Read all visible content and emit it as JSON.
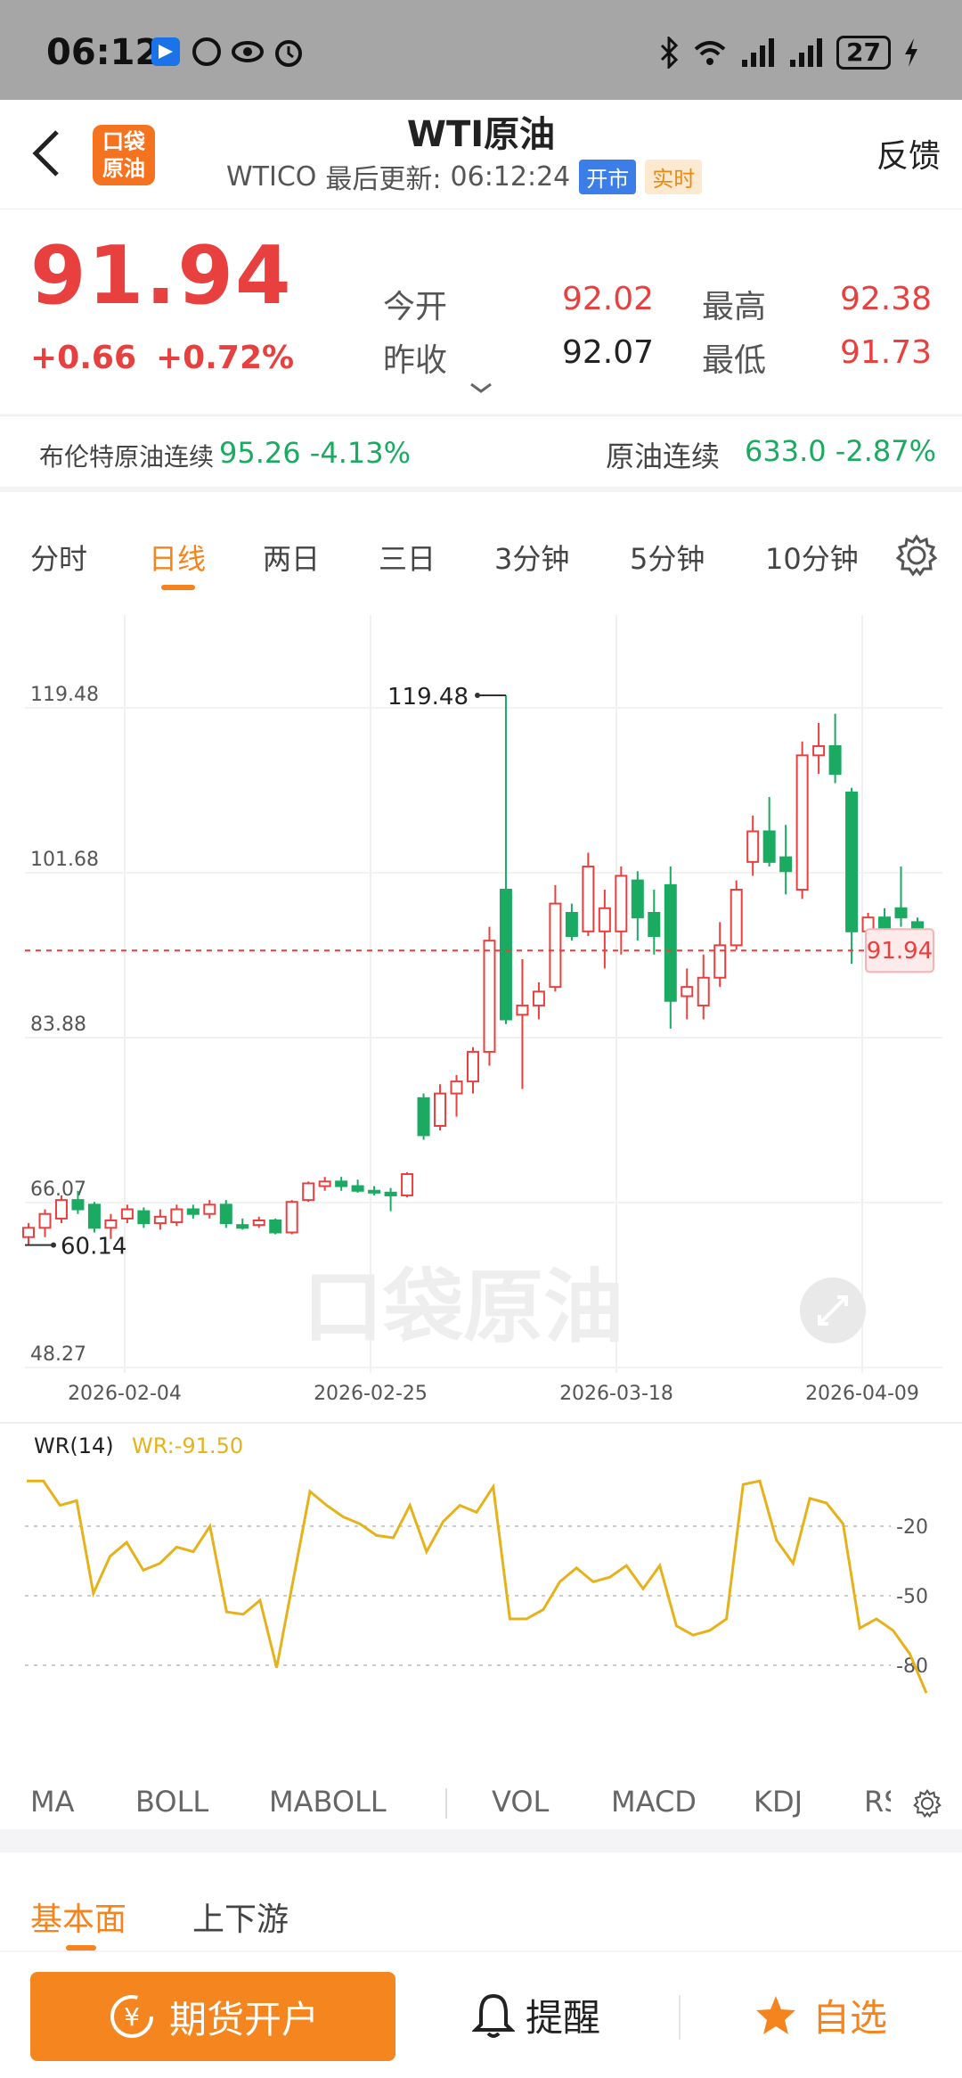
{
  "status_bar": {
    "time": "06:12",
    "battery": "27"
  },
  "header": {
    "logo_text_top": "口袋",
    "logo_text_bottom": "原油",
    "title": "WTI原油",
    "code": "WTICO",
    "update_label": "最后更新:",
    "update_time": "06:12:24",
    "tag_open": "开市",
    "tag_live": "实时",
    "feedback": "反馈"
  },
  "quote": {
    "price": "91.94",
    "change": "+0.66",
    "change_pct": "+0.72%",
    "open_label": "今开",
    "open_value": "92.02",
    "high_label": "最高",
    "high_value": "92.38",
    "prev_close_label": "昨收",
    "prev_close_value": "92.07",
    "low_label": "最低",
    "low_value": "91.73",
    "colors": {
      "up": "#e8403f",
      "down": "#1aaa62"
    }
  },
  "related": {
    "brent_label": "布伦特原油连续",
    "brent_value": "95.26 -4.13%",
    "crude_label": "原油连续",
    "crude_value": "633.0 -2.87%"
  },
  "tabs": [
    {
      "label": "分时",
      "active": false
    },
    {
      "label": "日线",
      "active": true
    },
    {
      "label": "两日",
      "active": false
    },
    {
      "label": "三日",
      "active": false
    },
    {
      "label": "3分钟",
      "active": false
    },
    {
      "label": "5分钟",
      "active": false
    },
    {
      "label": "10分钟",
      "active": false
    }
  ],
  "chart_data": {
    "type": "candlestick",
    "title": "",
    "y_ticks": [
      "119.48",
      "101.68",
      "83.88",
      "66.07",
      "48.27"
    ],
    "ylim": [
      48.27,
      119.48
    ],
    "x_ticks": [
      "2026-02-04",
      "2026-02-25",
      "2026-03-18",
      "2026-04-09"
    ],
    "max_label": "119.48",
    "min_label": "60.14",
    "last_price_label": "91.94",
    "last_price": 91.94,
    "watermark": "口袋原油",
    "candles": [
      {
        "o": 61.0,
        "h": 62.5,
        "l": 60.14,
        "c": 62.0
      },
      {
        "o": 62.0,
        "h": 64.0,
        "l": 61.0,
        "c": 63.5
      },
      {
        "o": 63.0,
        "h": 65.5,
        "l": 62.5,
        "c": 65.0
      },
      {
        "o": 65.0,
        "h": 66.0,
        "l": 63.5,
        "c": 64.0
      },
      {
        "o": 64.5,
        "h": 64.8,
        "l": 61.5,
        "c": 62.0
      },
      {
        "o": 62.0,
        "h": 63.5,
        "l": 60.8,
        "c": 62.8
      },
      {
        "o": 63.0,
        "h": 64.5,
        "l": 62.5,
        "c": 64.0
      },
      {
        "o": 63.8,
        "h": 64.2,
        "l": 62.0,
        "c": 62.5
      },
      {
        "o": 62.5,
        "h": 64.0,
        "l": 61.8,
        "c": 63.2
      },
      {
        "o": 62.6,
        "h": 64.5,
        "l": 62.2,
        "c": 64.0
      },
      {
        "o": 64.0,
        "h": 64.5,
        "l": 63.0,
        "c": 63.5
      },
      {
        "o": 63.5,
        "h": 65.0,
        "l": 63.0,
        "c": 64.5
      },
      {
        "o": 64.5,
        "h": 65.0,
        "l": 62.0,
        "c": 62.5
      },
      {
        "o": 62.3,
        "h": 63.0,
        "l": 61.8,
        "c": 62.0
      },
      {
        "o": 62.3,
        "h": 63.2,
        "l": 62.0,
        "c": 62.8
      },
      {
        "o": 62.8,
        "h": 63.0,
        "l": 61.3,
        "c": 61.5
      },
      {
        "o": 61.5,
        "h": 65.0,
        "l": 61.3,
        "c": 64.8
      },
      {
        "o": 65.0,
        "h": 67.0,
        "l": 64.8,
        "c": 66.8
      },
      {
        "o": 66.5,
        "h": 67.5,
        "l": 66.0,
        "c": 67.0
      },
      {
        "o": 67.0,
        "h": 67.5,
        "l": 66.0,
        "c": 66.5
      },
      {
        "o": 66.5,
        "h": 67.2,
        "l": 65.8,
        "c": 66.0
      },
      {
        "o": 66.0,
        "h": 66.5,
        "l": 65.5,
        "c": 65.8
      },
      {
        "o": 65.8,
        "h": 66.3,
        "l": 63.8,
        "c": 65.5
      },
      {
        "o": 65.5,
        "h": 68.0,
        "l": 65.3,
        "c": 67.8
      },
      {
        "o": 76.0,
        "h": 76.5,
        "l": 71.5,
        "c": 72.0
      },
      {
        "o": 73.0,
        "h": 77.5,
        "l": 72.5,
        "c": 76.5
      },
      {
        "o": 76.5,
        "h": 78.5,
        "l": 74.0,
        "c": 77.8
      },
      {
        "o": 77.8,
        "h": 81.5,
        "l": 76.5,
        "c": 81.0
      },
      {
        "o": 81.0,
        "h": 94.5,
        "l": 79.5,
        "c": 93.0
      },
      {
        "o": 98.5,
        "h": 119.48,
        "l": 84.0,
        "c": 84.5
      },
      {
        "o": 85.0,
        "h": 91.0,
        "l": 77.0,
        "c": 86.0
      },
      {
        "o": 86.0,
        "h": 88.5,
        "l": 84.5,
        "c": 87.5
      },
      {
        "o": 88.0,
        "h": 99.0,
        "l": 87.5,
        "c": 97.0
      },
      {
        "o": 96.0,
        "h": 97.0,
        "l": 93.0,
        "c": 93.5
      },
      {
        "o": 94.0,
        "h": 102.5,
        "l": 93.5,
        "c": 101.0
      },
      {
        "o": 94.0,
        "h": 98.5,
        "l": 90.0,
        "c": 96.5
      },
      {
        "o": 94.0,
        "h": 101.0,
        "l": 91.5,
        "c": 100.0
      },
      {
        "o": 99.5,
        "h": 100.5,
        "l": 93.0,
        "c": 95.5
      },
      {
        "o": 96.0,
        "h": 98.5,
        "l": 91.5,
        "c": 93.5
      },
      {
        "o": 99.0,
        "h": 101.0,
        "l": 83.5,
        "c": 86.5
      },
      {
        "o": 87.0,
        "h": 90.0,
        "l": 84.5,
        "c": 88.0
      },
      {
        "o": 86.0,
        "h": 91.5,
        "l": 84.5,
        "c": 89.0
      },
      {
        "o": 89.0,
        "h": 95.0,
        "l": 88.0,
        "c": 92.5
      },
      {
        "o": 92.5,
        "h": 99.5,
        "l": 92.0,
        "c": 98.5
      },
      {
        "o": 101.5,
        "h": 106.5,
        "l": 100.0,
        "c": 104.8
      },
      {
        "o": 104.8,
        "h": 108.5,
        "l": 101.0,
        "c": 101.5
      },
      {
        "o": 102.0,
        "h": 105.5,
        "l": 98.0,
        "c": 100.5
      },
      {
        "o": 98.5,
        "h": 114.5,
        "l": 97.5,
        "c": 113.0
      },
      {
        "o": 113.0,
        "h": 116.5,
        "l": 111.0,
        "c": 114.0
      },
      {
        "o": 114.0,
        "h": 117.5,
        "l": 110.0,
        "c": 111.0
      },
      {
        "o": 109.0,
        "h": 109.5,
        "l": 90.5,
        "c": 94.0
      },
      {
        "o": 94.0,
        "h": 96.0,
        "l": 93.0,
        "c": 95.5
      },
      {
        "o": 95.5,
        "h": 96.5,
        "l": 92.5,
        "c": 93.0
      },
      {
        "o": 96.5,
        "h": 101.0,
        "l": 94.5,
        "c": 95.5
      },
      {
        "o": 95.0,
        "h": 95.5,
        "l": 91.73,
        "c": 91.94
      }
    ]
  },
  "wr": {
    "label": "WR(14)",
    "value_label": "WR:-91.50",
    "y_ticks": [
      "-20",
      "-50",
      "-80"
    ],
    "ylim": [
      -100,
      0
    ],
    "series": [
      -0.5,
      -0.5,
      -11,
      -9,
      -49,
      -33,
      -27,
      -39,
      -36,
      -29,
      -31,
      -20,
      -57,
      -58,
      -52,
      -81,
      -43,
      -5,
      -11,
      -16,
      -19,
      -24,
      -25,
      -11,
      -31,
      -18,
      -11,
      -14,
      -3,
      -60,
      -60,
      -56,
      -44,
      -38,
      -44,
      -42,
      -37,
      -47,
      -37,
      -63,
      -67,
      -65,
      -60,
      -2,
      -0.5,
      -26,
      -36,
      -8,
      -10,
      -19,
      -64,
      -60,
      -65,
      -75,
      -92
    ]
  },
  "indicators": [
    "MA",
    "BOLL",
    "MABOLL",
    "VOL",
    "MACD",
    "KDJ",
    "RS"
  ],
  "lower_tabs": [
    "基本面",
    "上下游"
  ],
  "bottom": {
    "open_account": "期货开户",
    "remind": "提醒",
    "favorite": "自选"
  }
}
